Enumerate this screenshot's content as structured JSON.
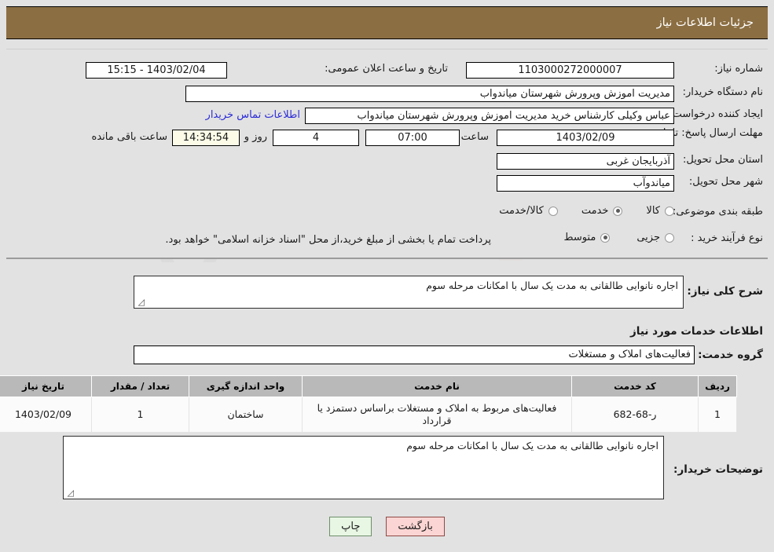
{
  "header": {
    "title": "جزئیات اطلاعات نیاز"
  },
  "colors": {
    "header_bg": "#8b6e42",
    "page_bg": "#e2e2e2",
    "link": "#2b2bd8",
    "table_header_bg": "#b9b9b9",
    "print_btn_bg": "#e8f6e4",
    "back_btn_bg": "#fbd5d3"
  },
  "form": {
    "need_number_label": "شماره نیاز:",
    "need_number_value": "1103000272000007",
    "public_announce_label": "تاریخ و ساعت اعلان عمومی:",
    "public_announce_value": "1403/02/04 - 15:15",
    "buyer_org_label": "نام دستگاه خریدار:",
    "buyer_org_value": "مدیریت اموزش وپرورش شهرستان میاندواب",
    "requester_label": "ایجاد کننده درخواست:",
    "requester_value": "عباس وکیلی کارشناس خرید مدیریت اموزش وپرورش شهرستان میاندواب",
    "contact_link": "اطلاعات تماس خریدار",
    "deadline_label": "مهلت ارسال پاسخ: تا تاریخ:",
    "deadline_date": "1403/02/09",
    "time_label": "ساعت",
    "deadline_time": "07:00",
    "days_value": "4",
    "days_and_label": "روز و",
    "remaining_time": "14:34:54",
    "remaining_label": "ساعت باقی مانده",
    "province_label": "استان محل تحویل:",
    "province_value": "آذربایجان غربی",
    "city_label": "شهر محل تحویل:",
    "city_value": "میاندوآب",
    "category_label": "طبقه بندی موضوعی:",
    "category_options": [
      {
        "label": "کالا",
        "selected": false
      },
      {
        "label": "خدمت",
        "selected": true
      },
      {
        "label": "کالا/خدمت",
        "selected": false
      }
    ],
    "purchase_type_label": "نوع فرآیند خرید :",
    "purchase_type_options": [
      {
        "label": "جزیی",
        "selected": false
      },
      {
        "label": "متوسط",
        "selected": true
      }
    ],
    "payment_note": "پرداخت تمام یا بخشی از مبلغ خرید،از محل \"اسناد خزانه اسلامی\" خواهد بود."
  },
  "general": {
    "need_desc_label": "شرح کلی نیاز:",
    "need_desc_value": "اجاره نانوایی طالقانی به مدت یک سال  با امکانات مرحله سوم",
    "services_section_title": "اطلاعات خدمات مورد نیاز",
    "service_group_label": "گروه خدمت:",
    "service_group_value": "فعالیت‌های  املاک و مستغلات"
  },
  "table": {
    "columns": [
      "ردیف",
      "کد خدمت",
      "نام خدمت",
      "واحد اندازه گیری",
      "تعداد / مقدار",
      "تاریخ نیاز"
    ],
    "rows": [
      {
        "row_no": "1",
        "service_code": "ر-68-682",
        "service_name": "فعالیت‌های مربوط به املاک و مستغلات براساس دستمزد یا قرارداد",
        "unit": "ساختمان",
        "quantity": "1",
        "need_date": "1403/02/09"
      }
    ]
  },
  "buyer_notes": {
    "label": "توضیحات خریدار:",
    "value": "اجاره نانوایی طالقانی به مدت یک سال  با امکانات مرحله سوم"
  },
  "footer": {
    "print_label": "چاپ",
    "back_label": "بازگشت"
  },
  "watermark": {
    "text": "AriaTender.net"
  }
}
